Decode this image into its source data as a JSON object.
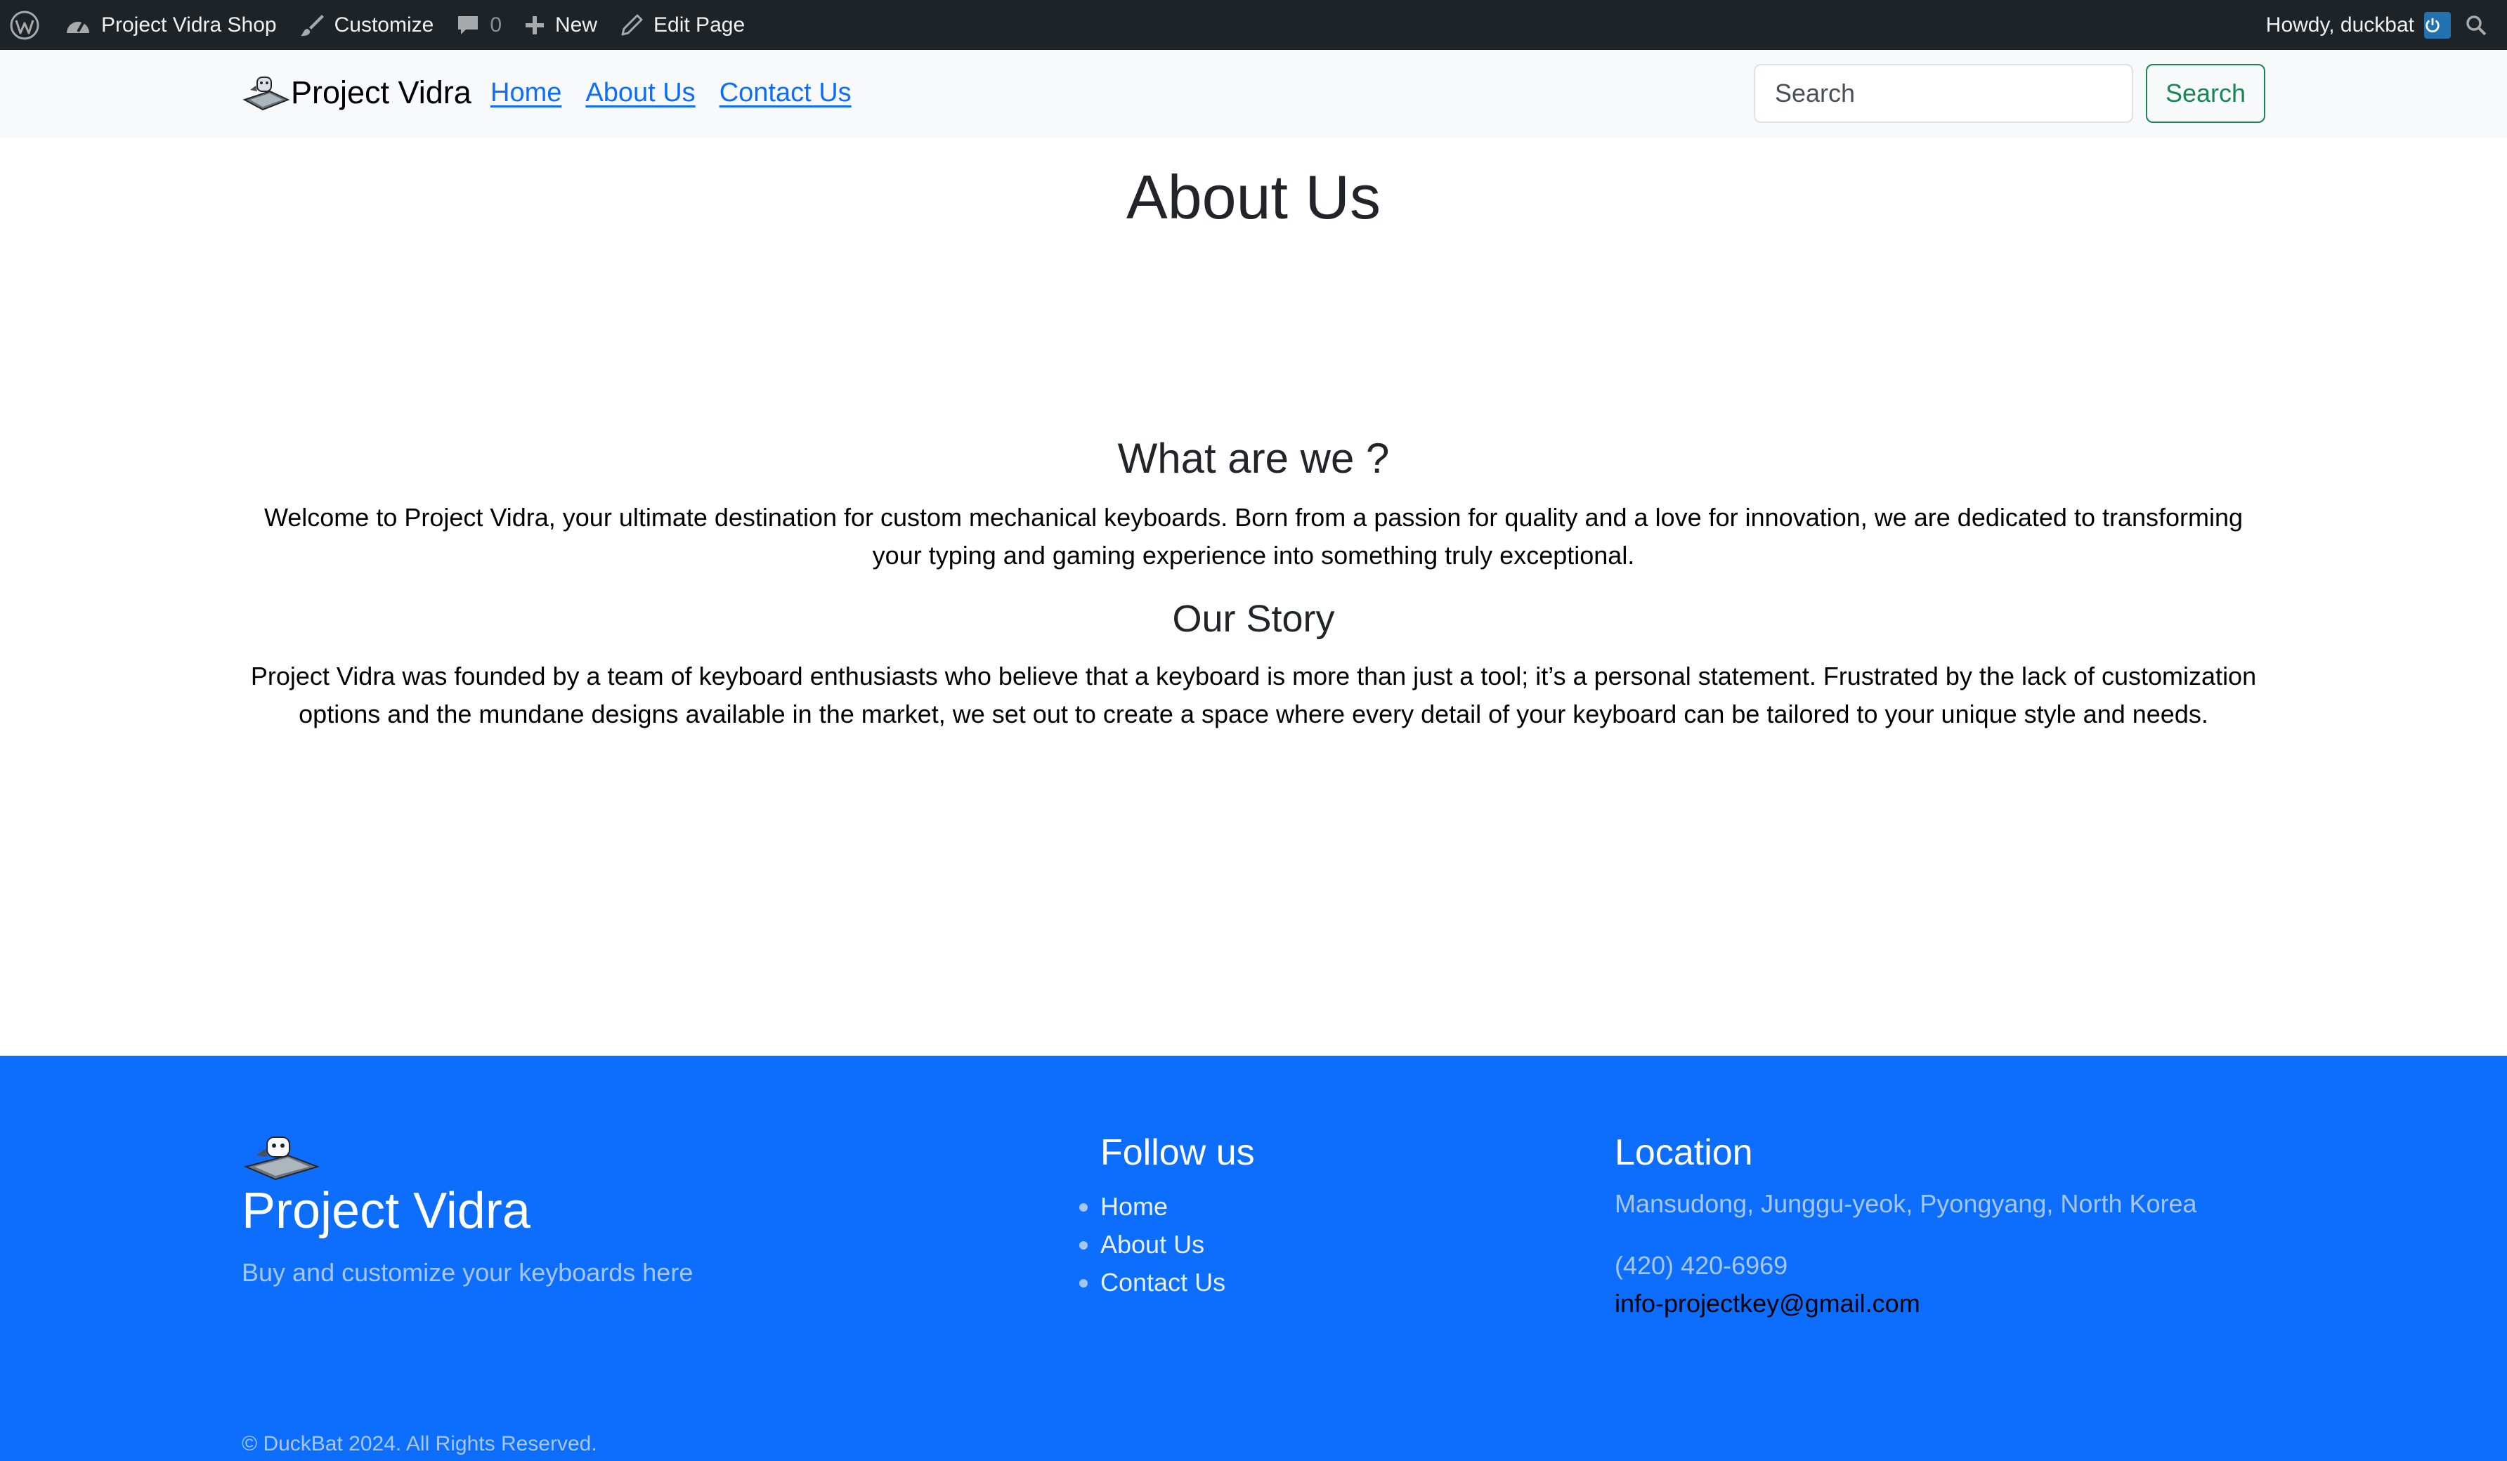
{
  "admin_bar": {
    "site_name": "Project Vidra Shop",
    "customize": "Customize",
    "comments_count": "0",
    "new": "New",
    "edit_page": "Edit Page",
    "greeting": "Howdy, duckbat"
  },
  "navbar": {
    "brand": "Project Vidra",
    "links": [
      "Home",
      "About Us",
      "Contact Us"
    ],
    "search_placeholder": "Search",
    "search_button": "Search"
  },
  "main": {
    "title": "About Us",
    "sections": [
      {
        "heading": "What are we ?",
        "body": "Welcome to Project Vidra, your ultimate destination for custom mechanical keyboards. Born from a passion for quality and a love for innovation, we are dedicated to transforming your typing and gaming experience into something truly exceptional."
      },
      {
        "heading": "Our Story",
        "body": "Project Vidra was founded by a team of keyboard enthusiasts who believe that a keyboard is more than just a tool; it’s a personal statement. Frustrated by the lack of customization options and the mundane designs available in the market, we set out to create a space where every detail of your keyboard can be tailored to your unique style and needs."
      }
    ]
  },
  "footer": {
    "brand": "Project Vidra",
    "tagline": "Buy and customize your keyboards here",
    "follow_heading": "Follow us",
    "follow_links": [
      "Home",
      "About Us",
      "Contact Us"
    ],
    "location_heading": "Location",
    "address": "Mansudong, Junggu-yeok, Pyongyang, North Korea",
    "phone": "(420) 420-6969",
    "email": "info-projectkey@gmail.com",
    "copyright": "© DuckBat 2024. All Rights Reserved."
  },
  "colors": {
    "admin_bar_bg": "#1d2327",
    "navbar_bg": "#f8f9fa",
    "link": "#0d6efd",
    "search_button": "#198754",
    "footer_bg": "#0d6efd"
  }
}
